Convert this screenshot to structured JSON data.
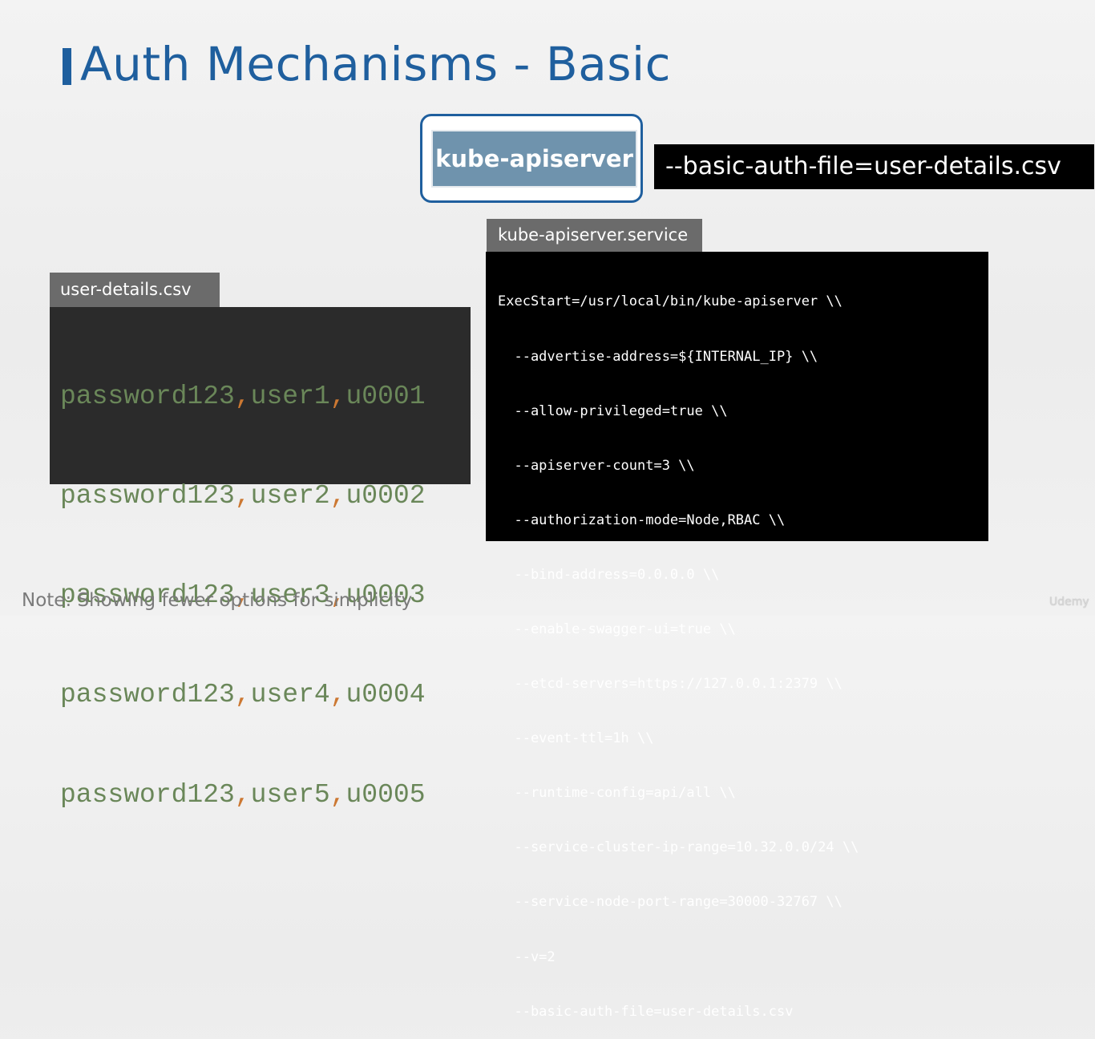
{
  "slide": {
    "title": "Auth Mechanisms - Basic",
    "accent_color": "#1f5f9e"
  },
  "server": {
    "label": "kube-apiserver",
    "box_color": "#6f93ad",
    "flag": "--basic-auth-file=user-details.csv"
  },
  "service_file": {
    "tab_label": "kube-apiserver.service",
    "lines": [
      "ExecStart=/usr/local/bin/kube-apiserver \\\\",
      "  --advertise-address=${INTERNAL_IP} \\\\",
      "  --allow-privileged=true \\\\",
      "  --apiserver-count=3 \\\\",
      "  --authorization-mode=Node,RBAC \\\\",
      "  --bind-address=0.0.0.0 \\\\",
      "  --enable-swagger-ui=true \\\\",
      "  --etcd-servers=https://127.0.0.1:2379 \\\\",
      "  --event-ttl=1h \\\\",
      "  --runtime-config=api/all \\\\",
      "  --service-cluster-ip-range=10.32.0.0/24 \\\\",
      "  --service-node-port-range=30000-32767 \\\\",
      "  --v=2",
      "  --basic-auth-file=user-details.csv"
    ]
  },
  "csv_file": {
    "tab_label": "user-details.csv",
    "rows": [
      {
        "password": "password123",
        "user": "user1",
        "id": "u0001"
      },
      {
        "password": "password123",
        "user": "user2",
        "id": "u0002"
      },
      {
        "password": "password123",
        "user": "user3",
        "id": "u0003"
      },
      {
        "password": "password123",
        "user": "user4",
        "id": "u0004"
      },
      {
        "password": "password123",
        "user": "user5",
        "id": "u0005"
      }
    ],
    "separator": ",",
    "colors": {
      "values": "#6a8759",
      "comma": "#cc7832"
    }
  },
  "footer": {
    "note": "Note: Showing fewer options for simplicity",
    "watermark": "Udemy"
  }
}
